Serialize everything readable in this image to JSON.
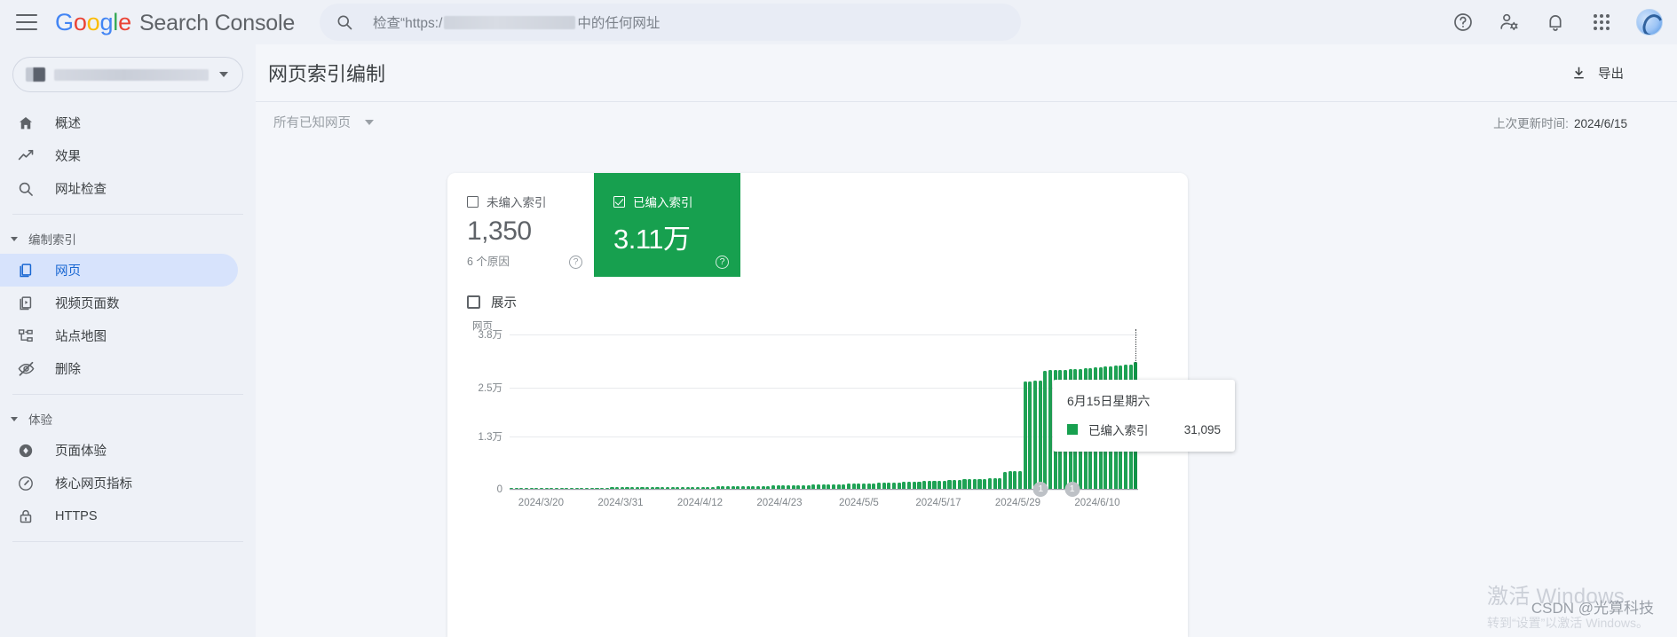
{
  "topbar": {
    "menu_icon": "hamburger-icon",
    "logo_letters": [
      "G",
      "o",
      "o",
      "g",
      "l",
      "e"
    ],
    "product_name": "Search Console",
    "search": {
      "icon": "search-icon",
      "placeholder_prefix": "检查“https:/",
      "placeholder_suffix": "中的任何网址",
      "value": ""
    },
    "icons": [
      {
        "name": "help-icon",
        "glyph": "?"
      },
      {
        "name": "user-settings-icon",
        "glyph": "person-gear"
      },
      {
        "name": "notifications-bell-icon",
        "glyph": "bell"
      },
      {
        "name": "apps-grid-icon",
        "glyph": "grid"
      },
      {
        "name": "account-avatar",
        "glyph": "avatar"
      }
    ]
  },
  "sidebar": {
    "property_selector": {
      "label": "",
      "caret": "chevron-down-icon"
    },
    "items": [
      {
        "label": "概述",
        "icon": "home-icon",
        "active": false
      },
      {
        "label": "效果",
        "icon": "trending-up-icon",
        "active": false
      },
      {
        "label": "网址检查",
        "icon": "search-icon",
        "active": false
      }
    ],
    "group_indexing": {
      "title": "编制索引",
      "items": [
        {
          "label": "网页",
          "icon": "pages-icon",
          "active": true
        },
        {
          "label": "视频页面数",
          "icon": "video-pages-icon",
          "active": false
        },
        {
          "label": "站点地图",
          "icon": "sitemap-icon",
          "active": false
        },
        {
          "label": "删除",
          "icon": "eye-off-icon",
          "active": false
        }
      ]
    },
    "group_experience": {
      "title": "体验",
      "items": [
        {
          "label": "页面体验",
          "icon": "page-experience-icon",
          "active": false
        },
        {
          "label": "核心网页指标",
          "icon": "core-web-vitals-icon",
          "active": false
        },
        {
          "label": "HTTPS",
          "icon": "lock-icon",
          "active": false
        }
      ]
    }
  },
  "main": {
    "page_title": "网页索引编制",
    "export_label": "导出",
    "export_icon": "download-icon",
    "filter_label": "所有已知网页",
    "filter_caret": "chevron-down-icon",
    "last_updated_label": "上次更新时间:",
    "last_updated_value": "2024/6/15"
  },
  "metrics": [
    {
      "name": "not-indexed",
      "label": "未编入索引",
      "value": "1,350",
      "sub": "6 个原因",
      "checked": false,
      "help_icon": "help-circle-icon"
    },
    {
      "name": "indexed",
      "label": "已编入索引",
      "value": "3.11万",
      "sub": "",
      "checked": true,
      "help_icon": "help-circle-icon",
      "color": "#17a04f"
    }
  ],
  "chart_legend": {
    "impressions_label": "展示",
    "checked": false
  },
  "tooltip": {
    "date": "6月15日星期六",
    "series_label": "已编入索引",
    "value": "31,095",
    "swatch_color": "#17a04f"
  },
  "watermark": {
    "line1": "激活 Windows",
    "line2": "转到“设置”以激活 Windows。",
    "csdn": "CSDN @光算科技"
  },
  "chart_data": {
    "type": "bar",
    "title": "",
    "xlabel": "",
    "ylabel": "网页",
    "ylim": [
      0,
      38000
    ],
    "ytick_labels": [
      "0",
      "1.3万",
      "2.5万",
      "3.8万"
    ],
    "ytick_values": [
      0,
      13000,
      25000,
      38000
    ],
    "grid": true,
    "legend_position": "top-left",
    "series": [
      {
        "name": "已编入索引",
        "color": "#1ea254",
        "values": [
          60,
          70,
          80,
          90,
          100,
          110,
          120,
          150,
          170,
          200,
          230,
          250,
          260,
          270,
          280,
          290,
          300,
          300,
          310,
          320,
          330,
          330,
          340,
          350,
          350,
          360,
          370,
          380,
          390,
          400,
          410,
          420,
          430,
          440,
          450,
          460,
          470,
          480,
          500,
          520,
          540,
          560,
          580,
          600,
          620,
          640,
          660,
          680,
          700,
          720,
          740,
          760,
          780,
          800,
          830,
          860,
          880,
          900,
          930,
          960,
          990,
          1020,
          1050,
          1080,
          1100,
          1150,
          1180,
          1200,
          1250,
          1280,
          1300,
          1350,
          1400,
          1450,
          1480,
          1500,
          1550,
          1600,
          1650,
          1700,
          1750,
          1800,
          1850,
          1900,
          1950,
          2000,
          2050,
          2100,
          2150,
          2200,
          2300,
          2350,
          2400,
          2450,
          2500,
          2550,
          2600,
          2650,
          4200,
          4250,
          4300,
          4350,
          26300,
          26350,
          26400,
          26450,
          28900,
          29000,
          29050,
          29100,
          29200,
          29300,
          29350,
          29400,
          29500,
          29600,
          29700,
          29800,
          29900,
          30000,
          30100,
          30200,
          30300,
          30400,
          31095
        ]
      }
    ],
    "x_tick_labels": [
      "2024/3/20",
      "2024/3/31",
      "2024/4/12",
      "2024/4/23",
      "2024/5/5",
      "2024/5/17",
      "2024/5/29",
      "2024/6/10"
    ],
    "annotations": [
      {
        "label": "1",
        "position_pct": 84.5
      },
      {
        "label": "1",
        "position_pct": 89.5
      }
    ],
    "highlight_index": 124,
    "hover_value": 31095,
    "hover_date": "6月15日星期六"
  }
}
